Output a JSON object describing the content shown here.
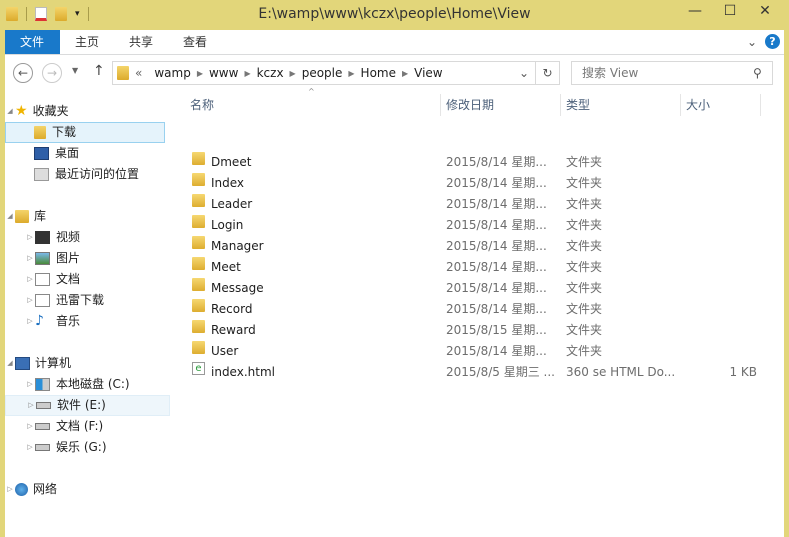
{
  "window": {
    "title": "E:\\wamp\\www\\kczx\\people\\Home\\View",
    "minimize": "—",
    "maximize": "☐",
    "close": "✕"
  },
  "ribbon": {
    "tabs": [
      "文件",
      "主页",
      "共享",
      "查看"
    ],
    "collapse": "⌄",
    "help": "?"
  },
  "address": {
    "overflow": "«",
    "crumbs": [
      "wamp",
      "www",
      "kczx",
      "people",
      "Home",
      "View"
    ],
    "dropdown": "⌄",
    "refresh": "↻"
  },
  "search": {
    "placeholder": "搜索 View"
  },
  "nav": {
    "favorites": {
      "label": "收藏夹",
      "items": [
        "下载",
        "桌面",
        "最近访问的位置"
      ]
    },
    "libraries": {
      "label": "库",
      "items": [
        "视频",
        "图片",
        "文档",
        "迅雷下载",
        "音乐"
      ]
    },
    "computer": {
      "label": "计算机",
      "items": [
        "本地磁盘 (C:)",
        "软件 (E:)",
        "文档 (F:)",
        "娱乐 (G:)"
      ]
    },
    "network": {
      "label": "网络"
    }
  },
  "columns": [
    "名称",
    "修改日期",
    "类型",
    "大小"
  ],
  "files": [
    {
      "name": "Dmeet",
      "date": "2015/8/14 星期...",
      "type": "文件夹",
      "size": "",
      "icon": "folder"
    },
    {
      "name": "Index",
      "date": "2015/8/14 星期...",
      "type": "文件夹",
      "size": "",
      "icon": "folder"
    },
    {
      "name": "Leader",
      "date": "2015/8/14 星期...",
      "type": "文件夹",
      "size": "",
      "icon": "folder"
    },
    {
      "name": "Login",
      "date": "2015/8/14 星期...",
      "type": "文件夹",
      "size": "",
      "icon": "folder"
    },
    {
      "name": "Manager",
      "date": "2015/8/14 星期...",
      "type": "文件夹",
      "size": "",
      "icon": "folder"
    },
    {
      "name": "Meet",
      "date": "2015/8/14 星期...",
      "type": "文件夹",
      "size": "",
      "icon": "folder"
    },
    {
      "name": "Message",
      "date": "2015/8/14 星期...",
      "type": "文件夹",
      "size": "",
      "icon": "folder"
    },
    {
      "name": "Record",
      "date": "2015/8/14 星期...",
      "type": "文件夹",
      "size": "",
      "icon": "folder"
    },
    {
      "name": "Reward",
      "date": "2015/8/15 星期...",
      "type": "文件夹",
      "size": "",
      "icon": "folder"
    },
    {
      "name": "User",
      "date": "2015/8/14 星期...",
      "type": "文件夹",
      "size": "",
      "icon": "folder"
    },
    {
      "name": "index.html",
      "date": "2015/8/5 星期三 ...",
      "type": "360 se HTML Do...",
      "size": "1 KB",
      "icon": "html-file"
    }
  ],
  "colors": {
    "frame": "#e2d67a",
    "file_tab": "#1979ca",
    "selection": "#e5f3fb"
  }
}
